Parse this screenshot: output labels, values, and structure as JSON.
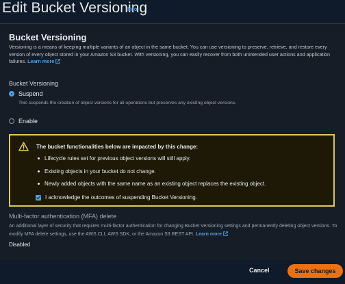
{
  "page": {
    "title": "Edit Bucket Versioning",
    "info_label": "Info"
  },
  "versioning": {
    "section_title": "Bucket Versioning",
    "description": "Versioning is a means of keeping multiple variants of an object in the same bucket. You can use versioning to preserve, retrieve, and restore every version of every object stored in your Amazon S3 bucket. With versioning, you can easily recover from both unintended user actions and application failures.",
    "learn_more": "Learn more",
    "field_label": "Bucket Versioning",
    "options": [
      {
        "label": "Suspend",
        "checked": true,
        "help": "This suspends the creation of object versions for all operations but preserves any existing object versions."
      },
      {
        "label": "Enable",
        "checked": false
      }
    ]
  },
  "alert": {
    "type": "warning",
    "title": "The bucket functionalities below are impacted by this change:",
    "items": [
      "Lifecycle rules set for previous object versions will still apply.",
      "Existing objects in your bucket do not change.",
      "Newly added objects with the same name as an existing object replaces the existing object."
    ],
    "acknowledge_label": "I acknowledge the outcomes of suspending Bucket Versioning.",
    "acknowledged": true
  },
  "mfa": {
    "title": "Multi-factor authentication (MFA) delete",
    "description": "An additional layer of security that requires multi-factor authentication for changing Bucket Versioning settings and permanently deleting object versions. To modify MFA delete settings, use the AWS CLI, AWS SDK, or the Amazon S3 REST API.",
    "learn_more": "Learn more",
    "value": "Disabled"
  },
  "actions": {
    "cancel_label": "Cancel",
    "save_label": "Save changes"
  },
  "colors": {
    "accent": "#ec7211",
    "link": "#539fe5",
    "warning_border": "#e0ca57"
  },
  "icons": {
    "external_link": "external-link-icon",
    "warning": "warning-icon"
  }
}
